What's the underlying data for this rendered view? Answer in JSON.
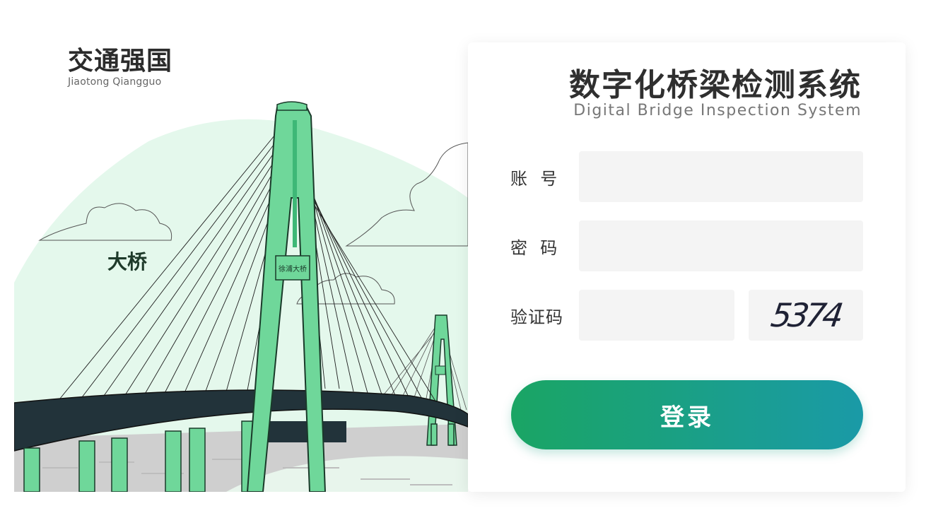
{
  "brand": {
    "name_cn": "交通强国",
    "name_en": "Jiaotong Qiangguo"
  },
  "illustration": {
    "bridge_sign_label": "大桥",
    "tower_sign_label": "徐浦大桥",
    "colors": {
      "green": "#6fd79a",
      "pale_green": "#e4f8ec",
      "deck": "#22333a",
      "ground": "#c8c8c8"
    }
  },
  "login": {
    "title_cn": "数字化桥梁检测系统",
    "title_en": "Digital Bridge Inspection System",
    "fields": {
      "account_label": "账  号",
      "account_value": "",
      "password_label": "密  码",
      "password_value": "",
      "captcha_label": "验证码",
      "captcha_value": "",
      "captcha_image_text": "5374"
    },
    "submit_label": "登录",
    "colors": {
      "button_gradient_start": "#1aa564",
      "button_gradient_end": "#1a9aa7",
      "input_bg": "#f4f4f4"
    }
  }
}
